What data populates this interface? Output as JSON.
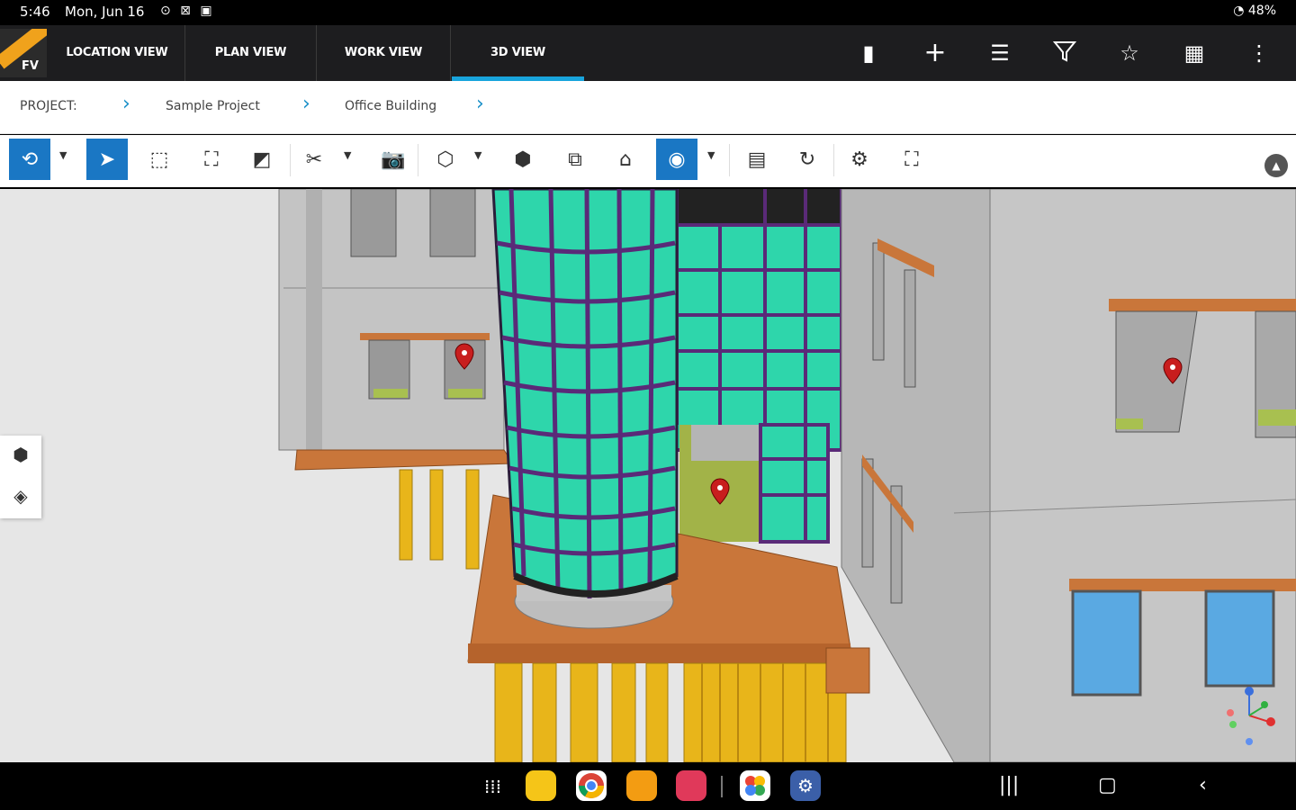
{
  "status": {
    "time": "5:46",
    "date": "Mon, Jun 16",
    "icons": "⊙ ⊠ ▣",
    "battery": "48%"
  },
  "app": {
    "logo": "FV",
    "tabs": [
      "LOCATION VIEW",
      "PLAN VIEW",
      "WORK VIEW",
      "3D VIEW"
    ],
    "active_tab": "3D VIEW",
    "actions": [
      "scan-icon",
      "plus-icon",
      "list-icon",
      "filter-icon",
      "star-icon",
      "qr-icon",
      "more-icon"
    ]
  },
  "breadcrumb": {
    "label": "PROJECT:",
    "items": [
      "Sample Project",
      "Office Building"
    ]
  },
  "toolbar": {
    "tools": [
      "orbit",
      "select",
      "box-select",
      "fit",
      "section",
      "cut",
      "snapshot",
      "cube",
      "box",
      "layers",
      "ghost",
      "visibility",
      "calculator",
      "reset",
      "settings",
      "fullscreen"
    ],
    "active": [
      "orbit",
      "select",
      "visibility"
    ]
  },
  "colors": {
    "accent": "#18a4dc",
    "glass": "#2ed6ab",
    "mullion": "#5a2a78",
    "slab": "#c9763a",
    "pile": "#e8b51a",
    "wall": "#bdbdbd",
    "active_tool": "#1a77c4"
  },
  "dock": [
    "apps-icon",
    "files-icon",
    "chrome-icon",
    "app-icon",
    "camera-icon",
    "photos-icon",
    "settings-icon"
  ]
}
